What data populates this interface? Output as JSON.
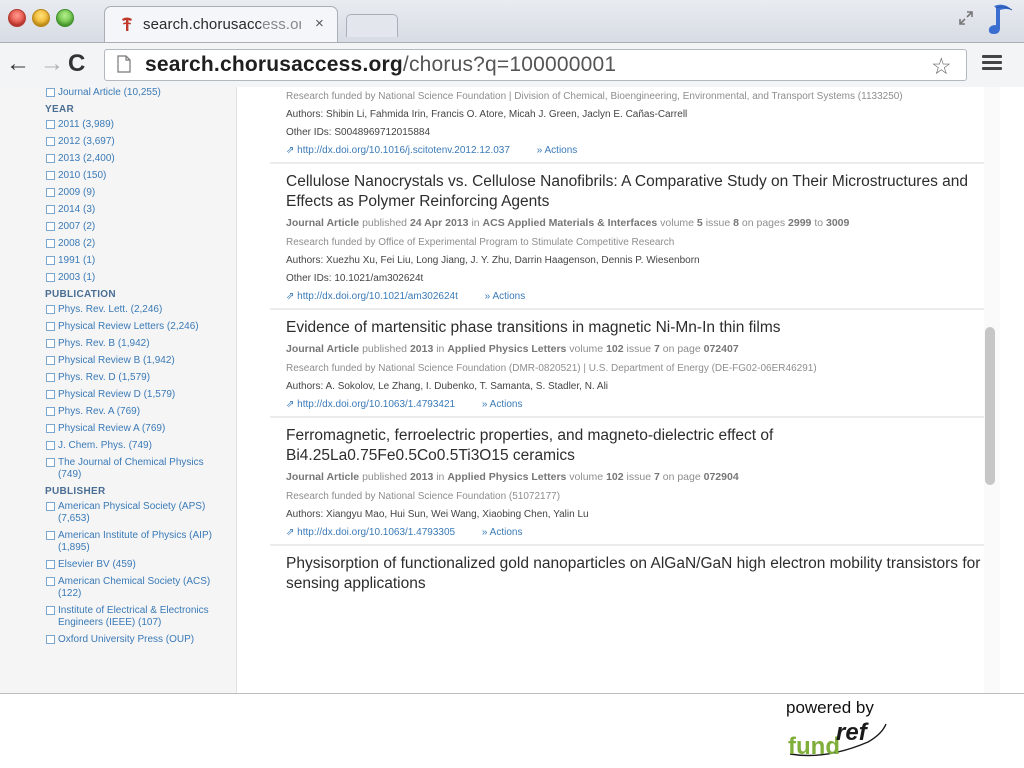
{
  "browser": {
    "tab_title_main": "search.chorusacc",
    "tab_title_fade": "ess.org/c",
    "tab_close": "×",
    "url_host": "search.chorusaccess.org",
    "url_path": "/chorus?q=100000001",
    "back": "←",
    "forward": "→",
    "reload": "C",
    "star": "☆"
  },
  "sidebar": {
    "facets_top": [
      {
        "label": "Journal Article (10,255)"
      }
    ],
    "year_heading": "YEAR",
    "years": [
      {
        "label": "2011 (3,989)"
      },
      {
        "label": "2012 (3,697)"
      },
      {
        "label": "2013 (2,400)"
      },
      {
        "label": "2010 (150)"
      },
      {
        "label": "2009 (9)"
      },
      {
        "label": "2014 (3)"
      },
      {
        "label": "2007 (2)"
      },
      {
        "label": "2008 (2)"
      },
      {
        "label": "1991 (1)"
      },
      {
        "label": "2003 (1)"
      }
    ],
    "publication_heading": "PUBLICATION",
    "publications": [
      {
        "label": "Phys. Rev. Lett. (2,246)"
      },
      {
        "label": "Physical Review Letters (2,246)"
      },
      {
        "label": "Phys. Rev. B (1,942)"
      },
      {
        "label": "Physical Review B (1,942)"
      },
      {
        "label": "Phys. Rev. D (1,579)"
      },
      {
        "label": "Physical Review D (1,579)"
      },
      {
        "label": "Phys. Rev. A (769)"
      },
      {
        "label": "Physical Review A (769)"
      },
      {
        "label": "J. Chem. Phys. (749)"
      },
      {
        "label": "The Journal of Chemical Physics (749)"
      }
    ],
    "publisher_heading": "PUBLISHER",
    "publishers": [
      {
        "label": "American Physical Society (APS) (7,653)"
      },
      {
        "label": "American Institute of Physics (AIP) (1,895)"
      },
      {
        "label": "Elsevier BV (459)"
      },
      {
        "label": "American Chemical Society (ACS) (122)"
      },
      {
        "label": "Institute of Electrical & Electronics Engineers (IEEE) (107)"
      },
      {
        "label": "Oxford University Press (OUP)"
      }
    ]
  },
  "results": {
    "r0": {
      "funding": "Research funded by National Science Foundation | Division of Chemical, Bioengineering, Environmental, and Transport Systems (1133250)",
      "authors": "Authors: Shibin Li, Fahmida Irin, Francis O. Atore, Micah J. Green, Jaclyn E. Cañas-Carrell",
      "other_ids": "Other IDs: S0048969712015884",
      "doi": "http://dx.doi.org/10.1016/j.scitotenv.2012.12.037",
      "actions": "Actions"
    },
    "r1": {
      "title": "Cellulose Nanocrystals vs. Cellulose Nanofibrils: A Comparative Study on Their Microstructures and Effects as Polymer Reinforcing Agents",
      "type": "Journal Article",
      "published_word": "published",
      "date": "24 Apr 2013",
      "in_word": "in",
      "journal": "ACS Applied Materials & Interfaces",
      "volume_word": "volume",
      "volume": "5",
      "issue_word": "issue",
      "issue": "8",
      "pages_word": "on pages",
      "page_start": "2999",
      "to_word": "to",
      "page_end": "3009",
      "funding": "Research funded by Office of Experimental Program to Stimulate Competitive Research",
      "authors": "Authors: Xuezhu Xu, Fei Liu, Long Jiang, J. Y. Zhu, Darrin Haagenson, Dennis P. Wiesenborn",
      "other_ids": "Other IDs: 10.1021/am302624t",
      "doi": "http://dx.doi.org/10.1021/am302624t",
      "actions": "Actions"
    },
    "r2": {
      "title": "Evidence of martensitic phase transitions in magnetic Ni-Mn-In thin films",
      "type": "Journal Article",
      "published_word": "published",
      "date": "2013",
      "in_word": "in",
      "journal": "Applied Physics Letters",
      "volume_word": "volume",
      "volume": "102",
      "issue_word": "issue",
      "issue": "7",
      "page_word": "on page",
      "page": "072407",
      "funding": "Research funded by National Science Foundation (DMR-0820521) | U.S. Department of Energy (DE-FG02-06ER46291)",
      "authors": "Authors: A. Sokolov, Le Zhang, I. Dubenko, T. Samanta, S. Stadler, N. Ali",
      "doi": "http://dx.doi.org/10.1063/1.4793421",
      "actions": "Actions"
    },
    "r3": {
      "title": "Ferromagnetic, ferroelectric properties, and magneto-dielectric effect of Bi4.25La0.75Fe0.5Co0.5Ti3O15 ceramics",
      "type": "Journal Article",
      "published_word": "published",
      "date": "2013",
      "in_word": "in",
      "journal": "Applied Physics Letters",
      "volume_word": "volume",
      "volume": "102",
      "issue_word": "issue",
      "issue": "7",
      "page_word": "on page",
      "page": "072904",
      "funding": "Research funded by National Science Foundation (51072177)",
      "authors": "Authors: Xiangyu Mao, Hui Sun, Wei Wang, Xiaobing Chen, Yalin Lu",
      "doi": "http://dx.doi.org/10.1063/1.4793305",
      "actions": "Actions"
    },
    "r4": {
      "title": "Physisorption of functionalized gold nanoparticles on AlGaN/GaN high electron mobility transistors for sensing applications"
    }
  },
  "footer": {
    "powered_by": "powered by",
    "logo_ref": "ref",
    "logo_fund": "fund"
  },
  "colors": {
    "link": "#3a7ab7",
    "logo_green": "#7fae3a",
    "logo_dark": "#1a1a1a"
  }
}
